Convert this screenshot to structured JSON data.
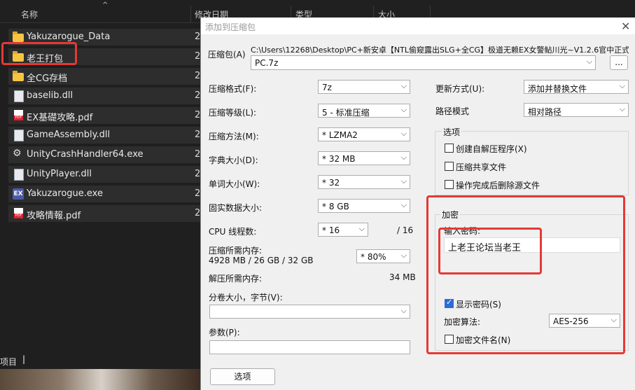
{
  "explorer": {
    "columns": {
      "name": "名称",
      "date": "修改日期",
      "type": "类型",
      "size": "大小"
    },
    "files": [
      {
        "name": "Yakuzarogue_Data",
        "icon": "folder-icon",
        "date": "2"
      },
      {
        "name": "老王打包",
        "icon": "folder-icon",
        "date": "2"
      },
      {
        "name": "全CG存档",
        "icon": "folder-icon",
        "date": "2"
      },
      {
        "name": "baselib.dll",
        "icon": "dll-file-icon",
        "date": "2"
      },
      {
        "name": "EX基礎攻略.pdf",
        "icon": "pdf-file-icon",
        "date": "2"
      },
      {
        "name": "GameAssembly.dll",
        "icon": "dll-file-icon",
        "date": "2"
      },
      {
        "name": "UnityCrashHandler64.exe",
        "icon": "gear-icon",
        "date": "2"
      },
      {
        "name": "UnityPlayer.dll",
        "icon": "dll-file-icon",
        "date": "2"
      },
      {
        "name": "Yakuzarogue.exe",
        "icon": "ex-app-icon",
        "date": "2"
      },
      {
        "name": "攻略情報.pdf",
        "icon": "pdf-file-icon",
        "date": "2"
      }
    ],
    "status": "项目"
  },
  "dialog": {
    "title": "添加到压缩包",
    "archive_label": "压缩包(A)",
    "archive_path": "C:\\Users\\12268\\Desktop\\PC+新安卓【NTL偷窥露出SLG+全CG】极道无赖EX女警鲇川光~V1.2.6官中正式",
    "archive_name": "PC.7z",
    "browse_label": "...",
    "format_label": "压缩格式(F):",
    "format_value": "7z",
    "level_label": "压缩等级(L):",
    "level_value": "5 - 标准压缩",
    "method_label": "压缩方法(M):",
    "method_value": "* LZMA2",
    "dict_label": "字典大小(D):",
    "dict_value": "* 32 MB",
    "word_label": "单词大小(W):",
    "word_value": "* 32",
    "solid_label": "固实数据大小:",
    "solid_value": "* 8 GB",
    "cpu_label": "CPU 线程数:",
    "cpu_value": "* 16",
    "cpu_total": "/ 16",
    "mem_comp_label": "压缩所需内存:",
    "mem_comp_value": "4928 MB / 26 GB / 32 GB",
    "mem_percent": "* 80%",
    "mem_decomp_label": "解压所需内存:",
    "mem_decomp_value": "34 MB",
    "split_label": "分卷大小，字节(V):",
    "split_value": "",
    "params_label": "参数(P):",
    "params_value": "",
    "options_button": "选项",
    "update_label": "更新方式(U):",
    "update_value": "添加并替换文件",
    "path_label": "路径模式",
    "path_value": "相对路径",
    "options_group": "选项",
    "opt_sfx": "创建自解压程序(X)",
    "opt_shared": "压缩共享文件",
    "opt_delete": "操作完成后删除源文件",
    "enc_group": "加密",
    "password_label": "输入密码:",
    "password_value": "上老王论坛当老王",
    "show_password": "显示密码(S)",
    "algo_label": "加密算法:",
    "algo_value": "AES-256",
    "encrypt_names": "加密文件名(N)"
  }
}
